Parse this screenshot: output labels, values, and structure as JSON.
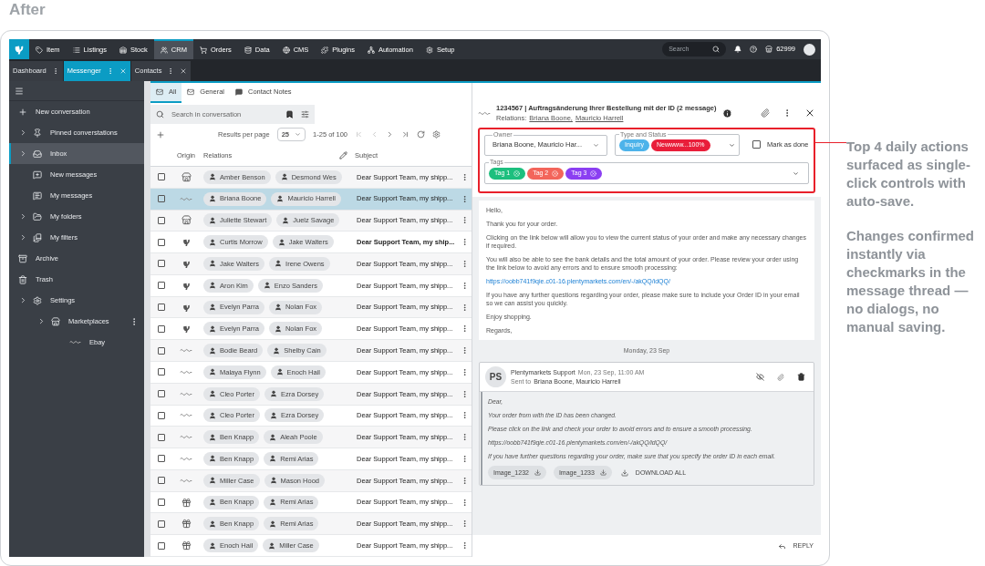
{
  "heading": "After",
  "nav": {
    "items": [
      {
        "label": "Item",
        "selected": false
      },
      {
        "label": "Listings",
        "selected": false
      },
      {
        "label": "Stock",
        "selected": false
      },
      {
        "label": "CRM",
        "selected": true
      },
      {
        "label": "Orders",
        "selected": false
      },
      {
        "label": "Data",
        "selected": false
      },
      {
        "label": "CMS",
        "selected": false
      },
      {
        "label": "Plugins",
        "selected": false
      },
      {
        "label": "Automation",
        "selected": false
      },
      {
        "label": "Setup",
        "selected": false
      }
    ],
    "search": {
      "placeholder": "Search"
    },
    "account": "62999"
  },
  "tabs": [
    {
      "label": "Dashboard",
      "selected": false,
      "closable": false
    },
    {
      "label": "Messenger",
      "selected": true,
      "closable": true
    },
    {
      "label": "Contacts",
      "selected": false,
      "closable": true
    }
  ],
  "sidebar": {
    "items": [
      {
        "label": "New conversation",
        "kind": "action",
        "selected": false
      },
      {
        "label": "Pinned converstations",
        "kind": "folder",
        "expanded": false,
        "selected": false
      },
      {
        "label": "Inbox",
        "kind": "folder",
        "expanded": false,
        "selected": true
      },
      {
        "label": "New messages",
        "kind": "leaf",
        "selected": false
      },
      {
        "label": "My messages",
        "kind": "leaf",
        "selected": false
      },
      {
        "label": "My folders",
        "kind": "folder",
        "expanded": false,
        "selected": false
      },
      {
        "label": "My filters",
        "kind": "folder",
        "expanded": false,
        "selected": false
      },
      {
        "label": "Archive",
        "kind": "action",
        "selected": false
      },
      {
        "label": "Trash",
        "kind": "action",
        "selected": false
      },
      {
        "label": "Settings",
        "kind": "folder",
        "expanded": false,
        "selected": false,
        "children": [
          {
            "label": "Marketplaces",
            "kind": "folder",
            "expanded": false,
            "selected": false,
            "children": [
              {
                "label": "Ebay",
                "kind": "leaf",
                "selected": false
              }
            ]
          }
        ]
      }
    ]
  },
  "list": {
    "tabs": [
      {
        "label": "All",
        "selected": true
      },
      {
        "label": "General",
        "selected": false
      },
      {
        "label": "Contact Notes",
        "selected": false
      }
    ],
    "search": {
      "placeholder": "Search in conversation"
    },
    "pagination": {
      "label": "Results per page",
      "per_page": "25",
      "range": "1-25 of 100"
    },
    "columns": [
      "Origin",
      "Relations",
      "Subject"
    ],
    "rows": [
      {
        "origin": {
          "kind": "store"
        },
        "relations": [
          "Amber Benson",
          "Desmond Wes"
        ],
        "subject": "Dear Support Team, my shipp...",
        "unread": false,
        "selected": false,
        "checked": false
      },
      {
        "origin": {
          "kind": "ebay"
        },
        "relations": [
          "Briana Boone",
          "Mauricio Harrell"
        ],
        "subject": "Dear Support Team, my shipp...",
        "unread": false,
        "selected": true,
        "checked": false
      },
      {
        "origin": {
          "kind": "store"
        },
        "relations": [
          "Juliette Stewart",
          "Juelz Savage"
        ],
        "subject": "Dear Support Team, my shipp...",
        "unread": false,
        "selected": false,
        "checked": false
      },
      {
        "origin": {
          "kind": "plenty"
        },
        "relations": [
          "Curtis Morrow",
          "Jake Walters"
        ],
        "subject": "Dear Support Team, my ship...",
        "unread": true,
        "selected": false,
        "checked": false
      },
      {
        "origin": {
          "kind": "plenty"
        },
        "relations": [
          "Jake Walters",
          "Irene Owens"
        ],
        "subject": "Dear Support Team, my shipp...",
        "unread": false,
        "selected": false,
        "checked": false
      },
      {
        "origin": {
          "kind": "plenty"
        },
        "relations": [
          "Aron Kim",
          "Enzo Sanders"
        ],
        "subject": "Dear Support Team, my shipp...",
        "unread": false,
        "selected": false,
        "checked": false
      },
      {
        "origin": {
          "kind": "plenty"
        },
        "relations": [
          "Evelyn Parra",
          "Nolan Fox"
        ],
        "subject": "Dear Support Team, my shipp...",
        "unread": false,
        "selected": false,
        "checked": false
      },
      {
        "origin": {
          "kind": "plenty"
        },
        "relations": [
          "Evelyn Parra",
          "Nolan Fox"
        ],
        "subject": "Dear Support Team, my shipp...",
        "unread": false,
        "selected": false,
        "checked": false
      },
      {
        "origin": {
          "kind": "ebay"
        },
        "relations": [
          "Bodie Beard",
          "Shelby Cain"
        ],
        "subject": "Dear Support Team, my shipp...",
        "unread": false,
        "selected": false,
        "checked": false
      },
      {
        "origin": {
          "kind": "ebay"
        },
        "relations": [
          "Malaya Flynn",
          "Enoch Hail"
        ],
        "subject": "Dear Support Team, my shipp...",
        "unread": false,
        "selected": false,
        "checked": false
      },
      {
        "origin": {
          "kind": "ebay"
        },
        "relations": [
          "Cleo Porter",
          "Ezra Dorsey"
        ],
        "subject": "Dear Support Team, my shipp...",
        "unread": false,
        "selected": false,
        "checked": false
      },
      {
        "origin": {
          "kind": "ebay"
        },
        "relations": [
          "Cleo Porter",
          "Ezra Dorsey"
        ],
        "subject": "Dear Support Team, my shipp...",
        "unread": false,
        "selected": false,
        "checked": false
      },
      {
        "origin": {
          "kind": "ebay"
        },
        "relations": [
          "Ben Knapp",
          "Aleah Poole"
        ],
        "subject": "Dear Support Team, my shipp...",
        "unread": false,
        "selected": false,
        "checked": false
      },
      {
        "origin": {
          "kind": "ebay"
        },
        "relations": [
          "Ben Knapp",
          "Remi Arias"
        ],
        "subject": "Dear Support Team, my shipp...",
        "unread": false,
        "selected": false,
        "checked": false
      },
      {
        "origin": {
          "kind": "ebay"
        },
        "relations": [
          "Miller Case",
          "Mason Hood"
        ],
        "subject": "Dear Support Team, my shipp...",
        "unread": false,
        "selected": false,
        "checked": false
      },
      {
        "origin": {
          "kind": "gift"
        },
        "relations": [
          "Ben Knapp",
          "Remi Arias"
        ],
        "subject": "Dear Support Team, my shipp...",
        "unread": false,
        "selected": false,
        "checked": false
      },
      {
        "origin": {
          "kind": "gift"
        },
        "relations": [
          "Ben Knapp",
          "Remi Arias"
        ],
        "subject": "Dear Support Team, my shipp...",
        "unread": false,
        "selected": false,
        "checked": false
      },
      {
        "origin": {
          "kind": "gift"
        },
        "relations": [
          "Enoch Hail",
          "Miller Case"
        ],
        "subject": "Dear Support Team, my shipp...",
        "unread": false,
        "selected": false,
        "checked": false
      }
    ]
  },
  "detail": {
    "origin": {
      "kind": "ebay"
    },
    "title": "1234567 | Auftragsänderung Ihrer Bestellung mit der ID (2 message)",
    "relations_label": "Relations:",
    "relations": [
      "Briana Boone,",
      "Mauricio Harrell"
    ],
    "owner": {
      "label": "Owner",
      "value": "Briana Boone, Mauricio Har..."
    },
    "type_status": {
      "label": "Type and Status",
      "chips": [
        {
          "label": "Inquiry",
          "color": "#4db3ea"
        },
        {
          "label": "Newwww...100%",
          "color": "#e91e3a"
        }
      ]
    },
    "mark_done": {
      "label": "Mark as done",
      "checked": false
    },
    "tags": {
      "label": "Tags",
      "items": [
        {
          "label": "Tag 1",
          "color": "#1dbf7e"
        },
        {
          "label": "Tag 2",
          "color": "#f3655b"
        },
        {
          "label": "Tag 3",
          "color": "#8b3ff2"
        }
      ]
    },
    "body": [
      {
        "kind": "text",
        "text": "Hello,"
      },
      {
        "kind": "text",
        "text": "Thank you for your order."
      },
      {
        "kind": "text",
        "text": "Clicking on the link below will allow you to view the current status of your order and make any necessary changes if required."
      },
      {
        "kind": "text",
        "text": "You will also be able to see the bank details and the total amount of your order. Please review your order using the link below to avoid any errors and to ensure smooth processing:"
      },
      {
        "kind": "link",
        "text": "https://oobb741f9qie.c01-16.plentymarkets.com/en/-/akQQ/idQQ/"
      },
      {
        "kind": "text",
        "text": "If you have any further questions regarding your order, please make sure to include your Order ID in your email so we can assist you quickly."
      },
      {
        "kind": "text",
        "text": "Enjoy shopping."
      },
      {
        "kind": "text",
        "text": "Regards,"
      }
    ],
    "date": "Monday, 23 Sep",
    "reply_message": {
      "initials": "PS",
      "sender": "Plentymarkets Support",
      "time": "Mon, 23 Sep, 11:00 AM",
      "sent_to_label": "Sent to",
      "sent_to": "Briana Boone, Mauricio Harrell",
      "body": [
        "Dear,",
        "Your order from with the ID has been changed.",
        "Please click on the link and check your order to avoid errors and to ensure a smooth processing.",
        "https://oobb741f9qie.c01-16.plentymarkets.com/en/-/akQQ/idQQ/",
        "If you have further questions regarding your order, make sure that you specify the order ID in each email."
      ],
      "attachments": [
        "Image_1232",
        "Image_1233"
      ],
      "download_all": "DOWNLOAD ALL"
    },
    "reply_button": "REPLY"
  },
  "annotation": [
    "Top 4 daily actions surfaced as single-click controls with auto-save.",
    "Changes confirmed instantly via checkmarks in the message thread — no dialogs, no manual saving."
  ]
}
